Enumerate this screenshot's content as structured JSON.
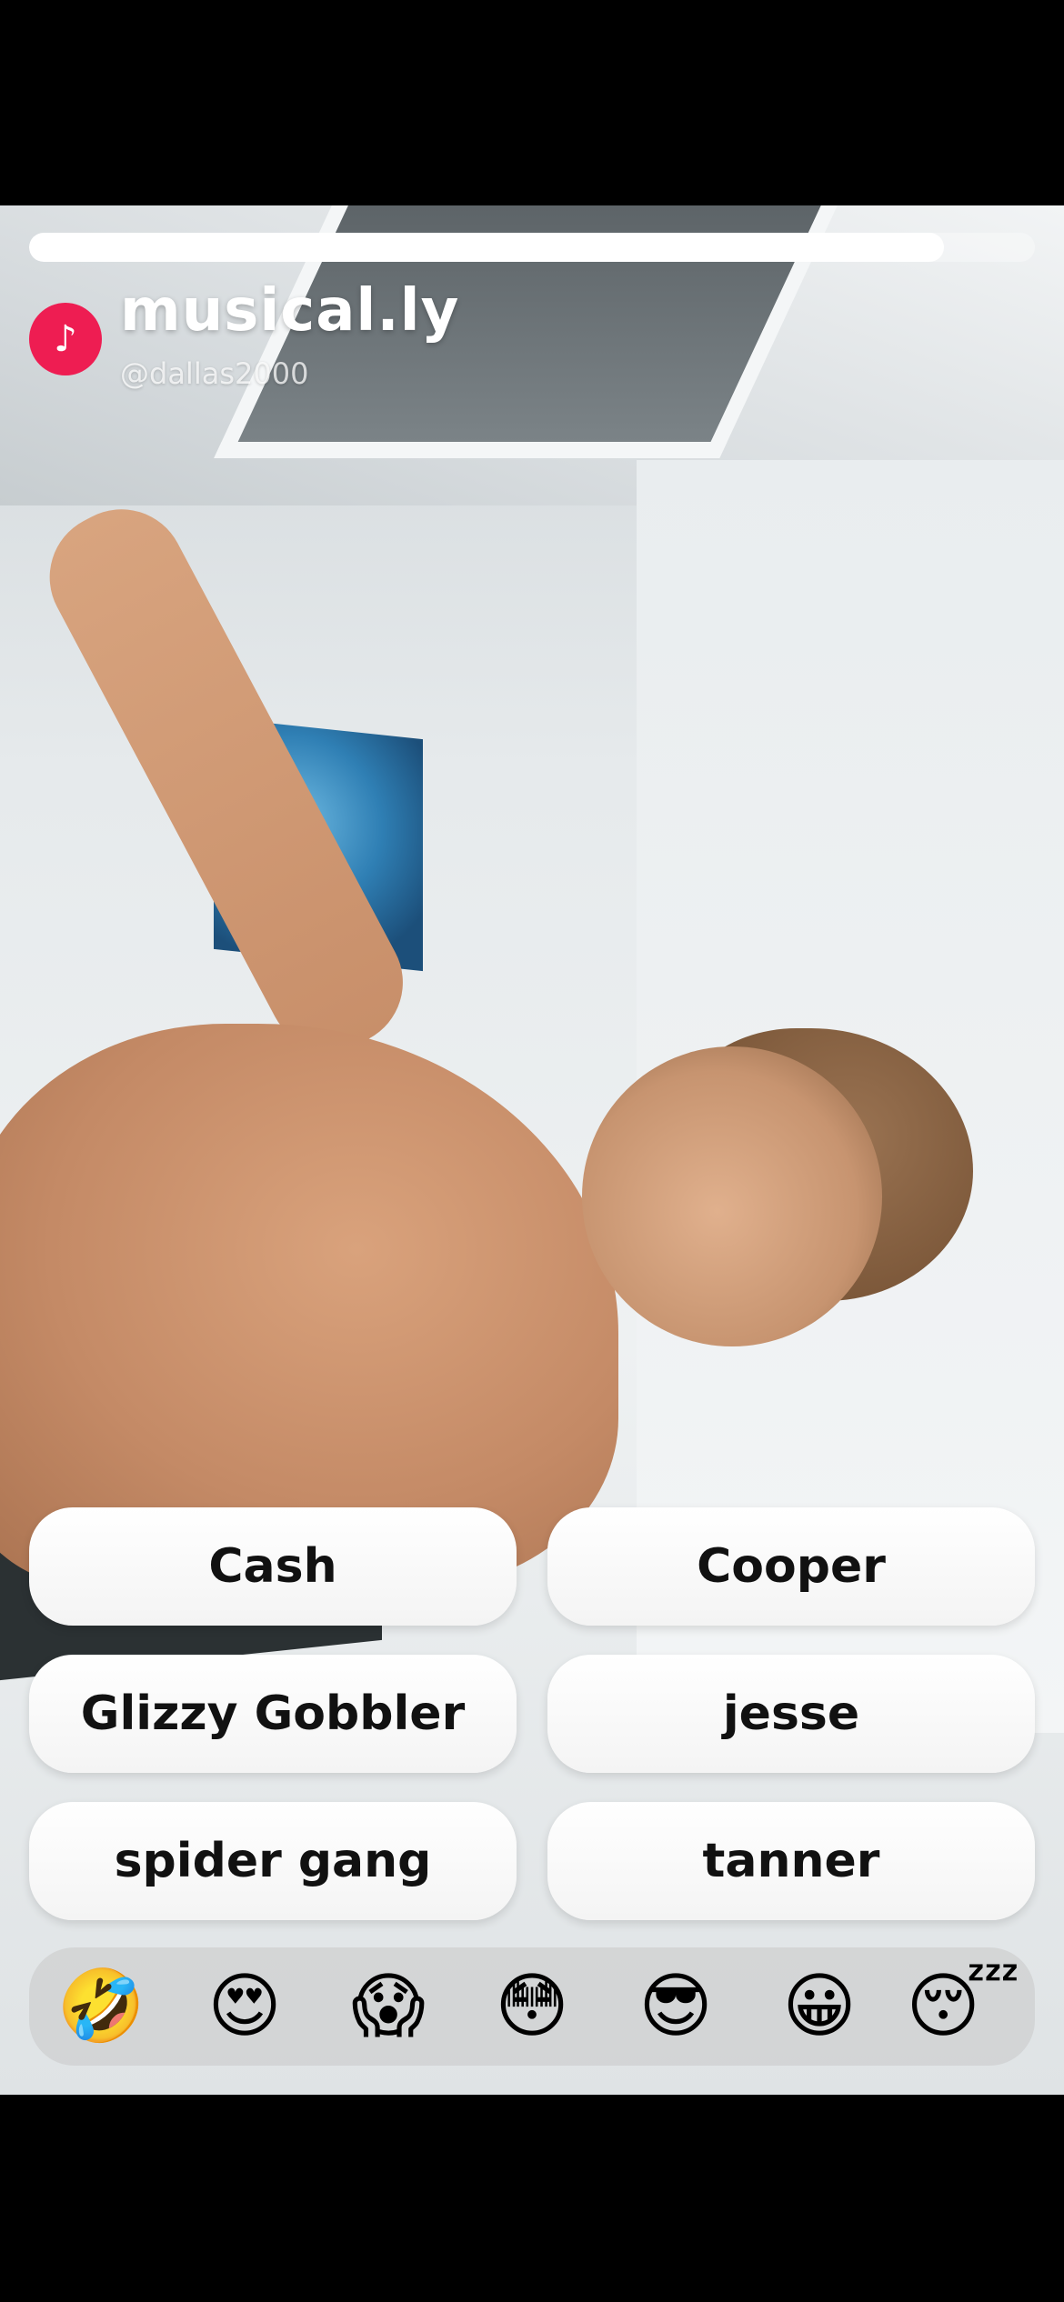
{
  "story": {
    "progress_fraction": 0.91,
    "app_name": "musical.ly",
    "account_subtext": "@dallas2000",
    "logo_icon": "music-note-icon"
  },
  "poll": {
    "options": [
      {
        "label": "Cash"
      },
      {
        "label": "Cooper"
      },
      {
        "label": "Glizzy Gobbler"
      },
      {
        "label": "jesse"
      },
      {
        "label": "spider gang"
      },
      {
        "label": "tanner"
      }
    ]
  },
  "reactions": [
    {
      "name": "rolling-laughing-emoji",
      "glyph": "🤣"
    },
    {
      "name": "heart-eyes-emoji",
      "glyph": "😍"
    },
    {
      "name": "screaming-emoji",
      "glyph": "😱"
    },
    {
      "name": "flushed-emoji",
      "glyph": "😳"
    },
    {
      "name": "sunglasses-emoji",
      "glyph": "😎"
    },
    {
      "name": "grinning-emoji",
      "glyph": "😀"
    },
    {
      "name": "sleeping-emoji",
      "glyph": "😴"
    }
  ],
  "colors": {
    "brand": "#ee1d52"
  }
}
